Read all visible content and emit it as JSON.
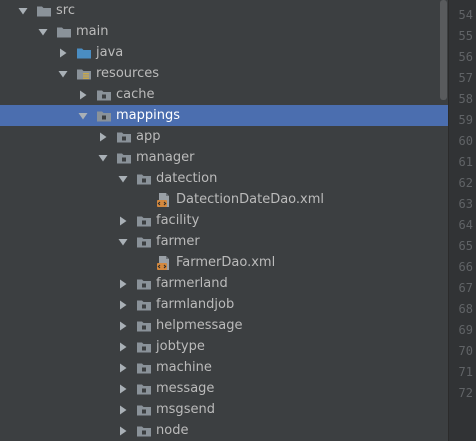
{
  "tree": [
    {
      "label": "src",
      "depth": 0,
      "expanded": true,
      "type": "folder"
    },
    {
      "label": "main",
      "depth": 1,
      "expanded": true,
      "type": "folder"
    },
    {
      "label": "java",
      "depth": 2,
      "expanded": false,
      "type": "source-folder"
    },
    {
      "label": "resources",
      "depth": 2,
      "expanded": true,
      "type": "resources-folder"
    },
    {
      "label": "cache",
      "depth": 3,
      "expanded": false,
      "type": "package"
    },
    {
      "label": "mappings",
      "depth": 3,
      "expanded": true,
      "type": "package",
      "selected": true
    },
    {
      "label": "app",
      "depth": 4,
      "expanded": false,
      "type": "package"
    },
    {
      "label": "manager",
      "depth": 4,
      "expanded": true,
      "type": "package"
    },
    {
      "label": "datection",
      "depth": 5,
      "expanded": true,
      "type": "package"
    },
    {
      "label": "DatectionDateDao.xml",
      "depth": 6,
      "type": "xml-file"
    },
    {
      "label": "facility",
      "depth": 5,
      "expanded": false,
      "type": "package"
    },
    {
      "label": "farmer",
      "depth": 5,
      "expanded": true,
      "type": "package"
    },
    {
      "label": "FarmerDao.xml",
      "depth": 6,
      "type": "xml-file"
    },
    {
      "label": "farmerland",
      "depth": 5,
      "expanded": false,
      "type": "package"
    },
    {
      "label": "farmlandjob",
      "depth": 5,
      "expanded": false,
      "type": "package"
    },
    {
      "label": "helpmessage",
      "depth": 5,
      "expanded": false,
      "type": "package"
    },
    {
      "label": "jobtype",
      "depth": 5,
      "expanded": false,
      "type": "package"
    },
    {
      "label": "machine",
      "depth": 5,
      "expanded": false,
      "type": "package"
    },
    {
      "label": "message",
      "depth": 5,
      "expanded": false,
      "type": "package"
    },
    {
      "label": "msgsend",
      "depth": 5,
      "expanded": false,
      "type": "package"
    },
    {
      "label": "node",
      "depth": 5,
      "expanded": false,
      "type": "package"
    }
  ],
  "gutter": {
    "line_numbers": [
      "54",
      "55",
      "56",
      "57",
      "58",
      "59",
      "60",
      "61",
      "62",
      "63",
      "64",
      "65",
      "66",
      "67",
      "68",
      "69",
      "70",
      "71",
      "72"
    ]
  },
  "colors": {
    "background": "#3c3f41",
    "selection": "#4b6eaf",
    "text": "#bbbbbb",
    "folder": "#8a9299",
    "source_folder": "#4a8dc2",
    "resources_folder": "#8a9299",
    "xml_badge": "#d3883e",
    "gutter_background": "#313335",
    "line_number": "#606366"
  }
}
